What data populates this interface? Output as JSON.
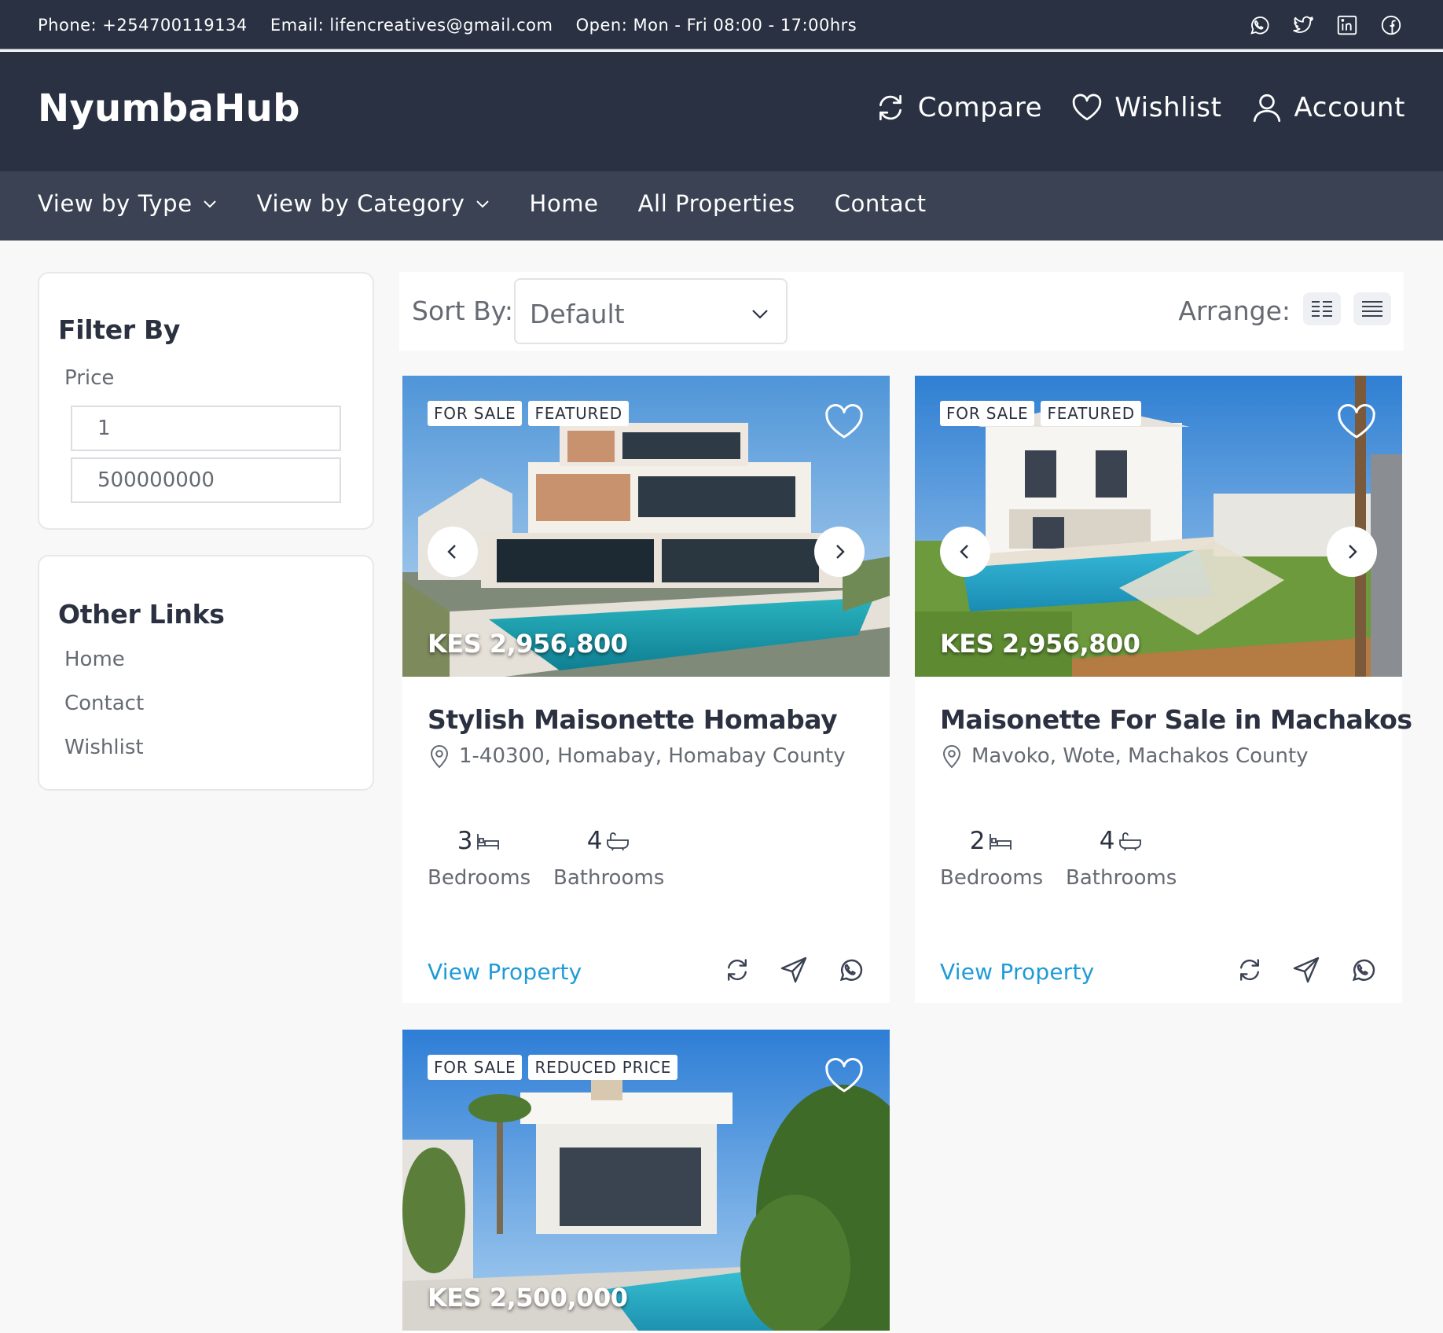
{
  "topbar": {
    "phone": "Phone: +254700119134",
    "email": "Email: lifencreatives@gmail.com",
    "hours": "Open: Mon - Fri 08:00 - 17:00hrs",
    "social_icons": [
      "whatsapp-icon",
      "twitter-icon",
      "linkedin-icon",
      "facebook-icon"
    ]
  },
  "header": {
    "logo": "NyumbaHub",
    "compare": "Compare",
    "wishlist": "Wishlist",
    "account": "Account"
  },
  "nav": {
    "items": [
      "View by Type",
      "View by Category",
      "Home",
      "All Properties",
      "Contact"
    ]
  },
  "sidebar": {
    "filter_title": "Filter By",
    "price_label": "Price",
    "price_min": "1",
    "price_max": "500000000",
    "links_title": "Other Links",
    "links": [
      "Home",
      "Contact",
      "Wishlist"
    ]
  },
  "toolbar": {
    "sort_label": "Sort By:",
    "sort_value": "Default",
    "arrange_label": "Arrange:"
  },
  "properties": [
    {
      "badges": [
        "FOR SALE",
        "FEATURED"
      ],
      "price": "KES 2,956,800",
      "title": "Stylish Maisonette Homabay",
      "location": "1-40300, Homabay, Homabay County",
      "bedrooms": "3",
      "bathrooms": "4",
      "bedrooms_label": "Bedrooms",
      "bathrooms_label": "Bathrooms",
      "link": "View Property"
    },
    {
      "badges": [
        "FOR SALE",
        "FEATURED"
      ],
      "price": "KES 2,956,800",
      "title": "Maisonette For Sale in Machakos",
      "location": "Mavoko, Wote, Machakos County",
      "bedrooms": "2",
      "bathrooms": "4",
      "bedrooms_label": "Bedrooms",
      "bathrooms_label": "Bathrooms",
      "link": "View Property"
    },
    {
      "badges": [
        "FOR SALE",
        "REDUCED PRICE"
      ],
      "price": "KES 2,500,000"
    }
  ],
  "colors": {
    "header_bg": "#293142",
    "nav_bg": "#3a4253",
    "link_blue": "#1f9bd7",
    "text_dark": "#2b3140",
    "text_muted": "#666a72"
  }
}
